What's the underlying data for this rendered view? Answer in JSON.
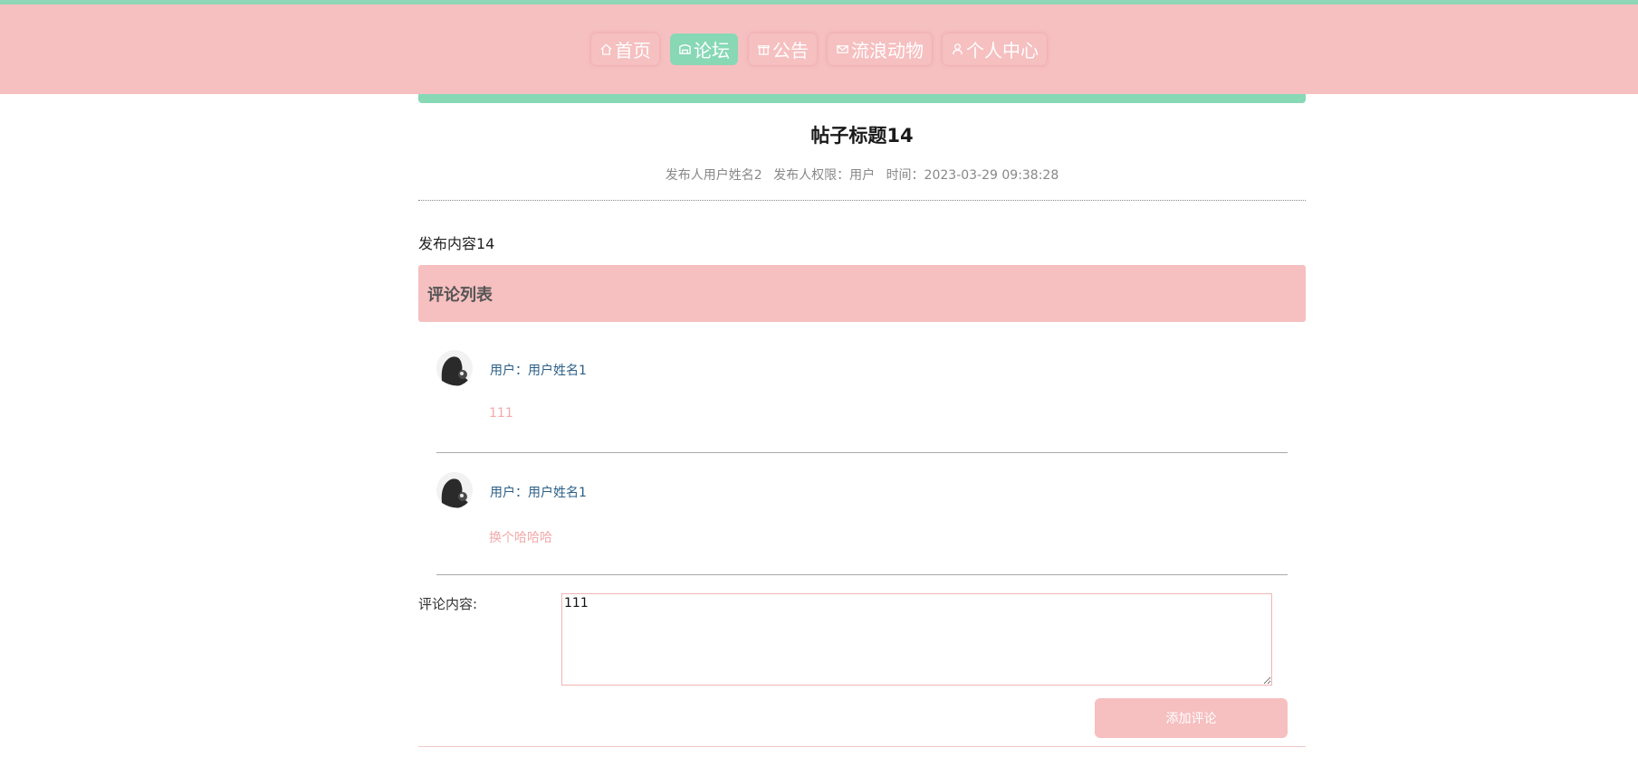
{
  "colors": {
    "header_bg": "#f6bfc0",
    "accent": "#88d8b6",
    "username": "#2b5f86",
    "comment_text": "#f2a9aa"
  },
  "nav": [
    {
      "label": "首页",
      "icon": "home-icon",
      "active": false
    },
    {
      "label": "论坛",
      "icon": "forum-icon",
      "active": true
    },
    {
      "label": "公告",
      "icon": "gift-icon",
      "active": false
    },
    {
      "label": "流浪动物",
      "icon": "mail-icon",
      "active": false
    },
    {
      "label": "个人中心",
      "icon": "user-icon",
      "active": false
    }
  ],
  "post": {
    "title": "帖子标题14",
    "author": "发布人用户姓名2",
    "role": "发布人权限：用户",
    "time": "时间：2023-03-29 09:38:28",
    "content": "发布内容14"
  },
  "comments": {
    "heading": "评论列表",
    "items": [
      {
        "user": "用户：用户姓名1",
        "text": "111",
        "avatar": "avatar-icon"
      },
      {
        "user": "用户：用户姓名1",
        "text": "换个哈哈哈",
        "avatar": "avatar-icon"
      }
    ]
  },
  "form": {
    "label": "评论内容:",
    "value": "111",
    "submit_label": "添加评论"
  }
}
